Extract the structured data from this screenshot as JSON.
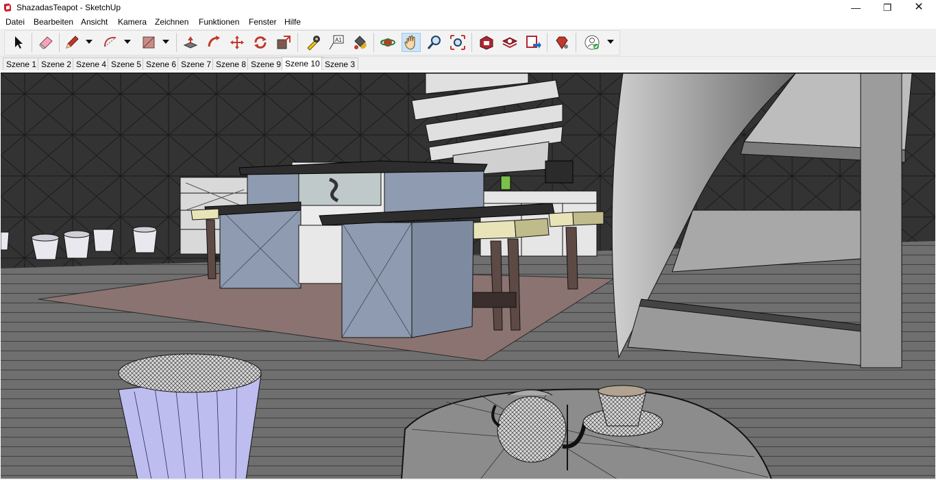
{
  "window": {
    "title": "ShazadasTeapot - SketchUp",
    "minimize": "—",
    "maximize": "❐",
    "close": "✕"
  },
  "menu": [
    "Datei",
    "Bearbeiten",
    "Ansicht",
    "Kamera",
    "Zeichnen",
    "Funktionen",
    "Fenster",
    "Hilfe"
  ],
  "toolbar": {
    "tools": [
      "select-icon",
      "eraser-icon",
      "pencil-icon",
      "arc-icon",
      "rectangle-icon",
      "push-pull-icon",
      "follow-me-icon",
      "move-icon",
      "rotate-icon",
      "scale-icon",
      "tape-measure-icon",
      "text-icon",
      "paint-bucket-icon",
      "orbit-icon",
      "pan-icon",
      "zoom-icon",
      "zoom-extents-icon",
      "warehouse-icon",
      "extension-warehouse-icon",
      "send-to-layout-icon",
      "ruby-extension-icon",
      "account-icon"
    ],
    "active_tool": "pan-icon",
    "text_tool_glyph": "A1"
  },
  "scenes": {
    "tabs": [
      "Szene 1",
      "Szene 2",
      "Szene 4",
      "Szene 5",
      "Szene 6",
      "Szene 7",
      "Szene 8",
      "Szene 9",
      "Szene 10",
      "Szene 3"
    ],
    "active": "Szene 10"
  },
  "colors": {
    "accent": "#0078d7",
    "sketchup_red": "#cc1f2a",
    "viewport_bg": "#3a3a3a",
    "floor": "#6e6e6e",
    "rug": "#8a7370",
    "block": "#8f9bb0",
    "stool_seat": "#e8e4b8"
  }
}
